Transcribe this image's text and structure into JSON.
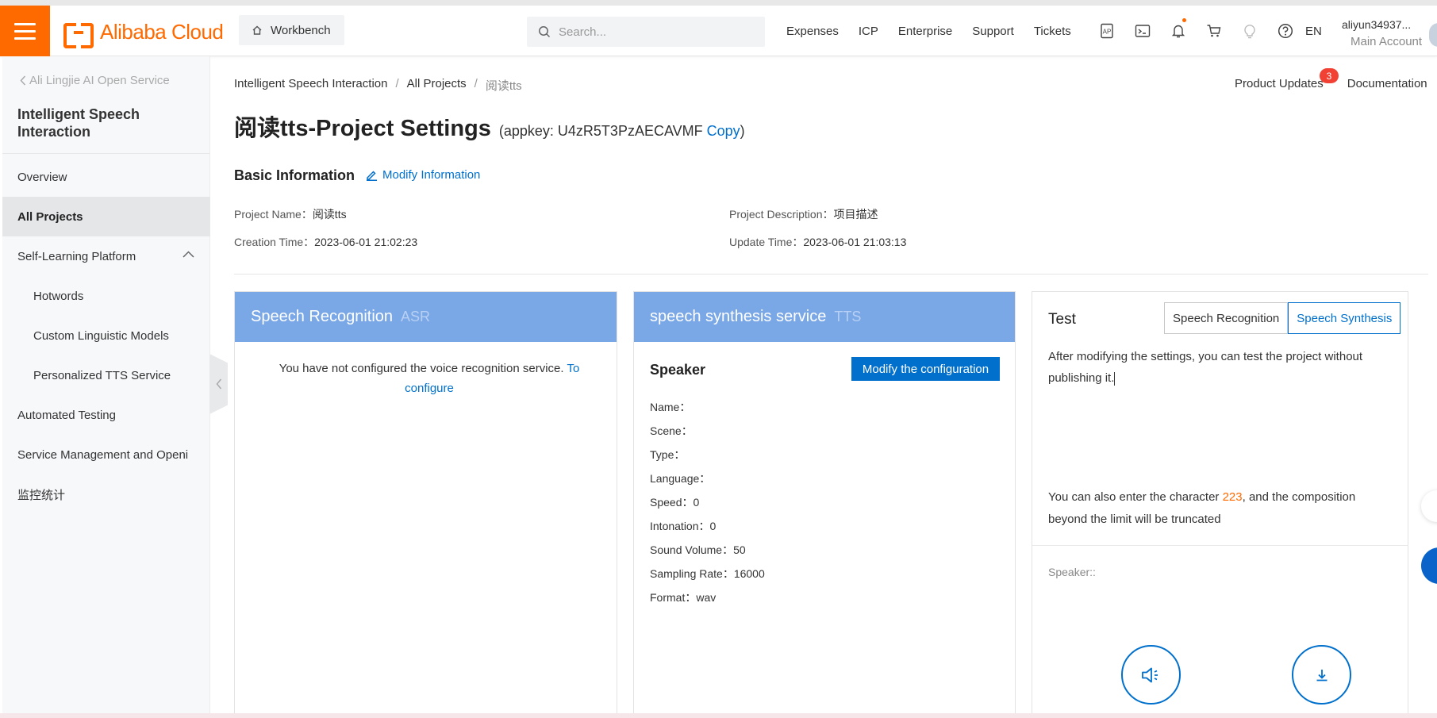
{
  "header": {
    "logo_text": "Alibaba Cloud",
    "workbench_label": "Workbench",
    "search_placeholder": "Search...",
    "nav": [
      "Expenses",
      "ICP",
      "Enterprise",
      "Support",
      "Tickets"
    ],
    "icons": [
      "app-icon",
      "terminal-icon",
      "bell-icon",
      "cart-icon",
      "bulb-icon",
      "help-icon"
    ],
    "language": "EN",
    "account_name": "aliyun34937...",
    "account_role": "Main Account"
  },
  "sidebar": {
    "back_label": "Ali Lingjie AI Open Service",
    "title": "Intelligent Speech Interaction",
    "items": [
      {
        "label": "Overview"
      },
      {
        "label": "All Projects"
      },
      {
        "label": "Self-Learning Platform"
      },
      {
        "label": "Hotwords"
      },
      {
        "label": "Custom Linguistic Models"
      },
      {
        "label": "Personalized TTS Service"
      },
      {
        "label": "Automated Testing"
      },
      {
        "label": "Service Management and Openi"
      },
      {
        "label": "监控统计"
      }
    ]
  },
  "breadcrumb": [
    "Intelligent Speech Interaction",
    "All Projects",
    "阅读tts"
  ],
  "top_links": {
    "updates": "Product Updates",
    "updates_badge": "3",
    "docs": "Documentation"
  },
  "page": {
    "title": "阅读tts-Project Settings",
    "appkey_prefix": "(appkey: U4zR5T3PzAECAVMF",
    "copy": "Copy",
    "appkey_suffix": ")"
  },
  "basic": {
    "heading": "Basic Information",
    "modify": "Modify Information",
    "project_name_label": "Project Name：",
    "project_name": "阅读tts",
    "creation_label": "Creation Time：",
    "creation_time": "2023-06-01 21:02:23",
    "desc_label": "Project Description：",
    "desc": "项目描述",
    "update_label": "Update Time：",
    "update_time": "2023-06-01 21:03:13"
  },
  "asr": {
    "title": "Speech Recognition",
    "tag": "ASR",
    "message": "You have not configured the voice recognition service.",
    "link": "To configure"
  },
  "tts": {
    "title": "speech synthesis service",
    "tag": "TTS",
    "speaker_heading": "Speaker",
    "modify_button": "Modify the configuration",
    "fields": [
      "Name：",
      "Scene：",
      "Type：",
      "Language：",
      "Speed：0",
      "Intonation：0",
      "Sound Volume：50",
      "Sampling Rate：16000",
      "Format：wav"
    ]
  },
  "test": {
    "title": "Test",
    "tab_asr": "Speech Recognition",
    "tab_tts": "Speech Synthesis",
    "input_text": "After modifying the settings, you can test the project without publishing it.",
    "limit_prefix": "You can also enter the character",
    "limit_number": "223",
    "limit_suffix": ", and the composition beyond the limit will be truncated",
    "speaker_label": "Speaker::"
  },
  "colors": {
    "accent": "#ff6a00",
    "link": "#0070cc",
    "card_header": "#7aa7e6",
    "badge": "#f04134"
  }
}
